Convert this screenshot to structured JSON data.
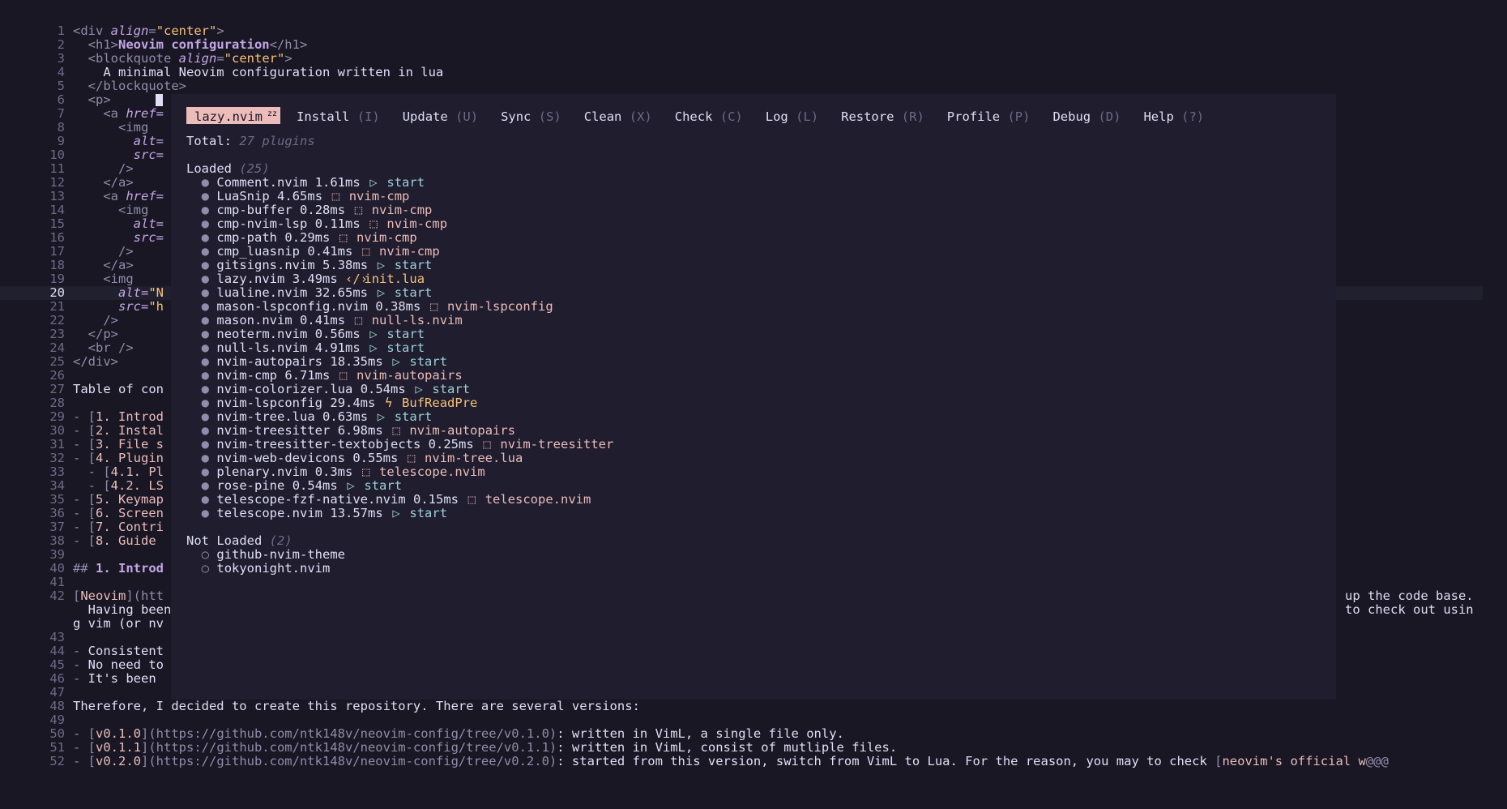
{
  "editor": {
    "lines": [
      {
        "n": "1",
        "segs": [
          [
            "tag",
            "<div "
          ],
          [
            "attr",
            "align"
          ],
          [
            "tag",
            "="
          ],
          [
            "str",
            "\"center\""
          ],
          [
            "tag",
            ">"
          ]
        ]
      },
      {
        "n": "2",
        "segs": [
          [
            "tag",
            "  <h1>"
          ],
          [
            "bold",
            "Neovim configuration"
          ],
          [
            "tag",
            "</h1>"
          ]
        ]
      },
      {
        "n": "3",
        "segs": [
          [
            "tag",
            "  <blockquote "
          ],
          [
            "attr",
            "align"
          ],
          [
            "tag",
            "="
          ],
          [
            "str",
            "\"center\""
          ],
          [
            "tag",
            ">"
          ]
        ]
      },
      {
        "n": "4",
        "segs": [
          [
            "",
            "    A minimal Neovim configuration written in lua"
          ]
        ]
      },
      {
        "n": "5",
        "segs": [
          [
            "tag",
            "  </blockquote>"
          ]
        ]
      },
      {
        "n": "6",
        "segs": [
          [
            "tag",
            "  <p>"
          ]
        ]
      },
      {
        "n": "7",
        "segs": [
          [
            "tag",
            "    <a "
          ],
          [
            "attr",
            "href="
          ]
        ]
      },
      {
        "n": "8",
        "segs": [
          [
            "tag",
            "      <img"
          ]
        ]
      },
      {
        "n": "9",
        "segs": [
          [
            "attr",
            "        alt="
          ]
        ]
      },
      {
        "n": "10",
        "segs": [
          [
            "attr",
            "        src="
          ]
        ]
      },
      {
        "n": "11",
        "segs": [
          [
            "tag",
            "      />"
          ]
        ]
      },
      {
        "n": "12",
        "segs": [
          [
            "tag",
            "    </a>"
          ]
        ]
      },
      {
        "n": "13",
        "segs": [
          [
            "tag",
            "    <a "
          ],
          [
            "attr",
            "href="
          ]
        ]
      },
      {
        "n": "14",
        "segs": [
          [
            "tag",
            "      <img"
          ]
        ]
      },
      {
        "n": "15",
        "segs": [
          [
            "attr",
            "        alt="
          ]
        ]
      },
      {
        "n": "16",
        "segs": [
          [
            "attr",
            "        src="
          ]
        ]
      },
      {
        "n": "17",
        "segs": [
          [
            "tag",
            "      />"
          ]
        ]
      },
      {
        "n": "18",
        "segs": [
          [
            "tag",
            "    </a>"
          ]
        ]
      },
      {
        "n": "19",
        "segs": [
          [
            "tag",
            "    <img"
          ]
        ]
      },
      {
        "n": "20",
        "segs": [
          [
            "attr",
            "      alt="
          ],
          [
            "str",
            "\"N"
          ]
        ],
        "current": true
      },
      {
        "n": "21",
        "segs": [
          [
            "attr",
            "      src="
          ],
          [
            "str",
            "\"h"
          ]
        ]
      },
      {
        "n": "22",
        "segs": [
          [
            "tag",
            "    />"
          ]
        ]
      },
      {
        "n": "23",
        "segs": [
          [
            "tag",
            "  </p>"
          ]
        ]
      },
      {
        "n": "24",
        "segs": [
          [
            "tag",
            "  <br />"
          ]
        ]
      },
      {
        "n": "25",
        "segs": [
          [
            "tag",
            "</div>"
          ]
        ]
      },
      {
        "n": "26",
        "segs": []
      },
      {
        "n": "27",
        "segs": [
          [
            "",
            "Table of con"
          ]
        ]
      },
      {
        "n": "28",
        "segs": []
      },
      {
        "n": "29",
        "segs": [
          [
            "muted",
            "- ["
          ],
          [
            "link",
            "1. Introd"
          ]
        ]
      },
      {
        "n": "30",
        "segs": [
          [
            "muted",
            "- ["
          ],
          [
            "link",
            "2. Instal"
          ]
        ]
      },
      {
        "n": "31",
        "segs": [
          [
            "muted",
            "- ["
          ],
          [
            "link",
            "3. File s"
          ]
        ]
      },
      {
        "n": "32",
        "segs": [
          [
            "muted",
            "- ["
          ],
          [
            "link",
            "4. Plugin"
          ]
        ]
      },
      {
        "n": "33",
        "segs": [
          [
            "muted",
            "  - ["
          ],
          [
            "link",
            "4.1. Pl"
          ]
        ]
      },
      {
        "n": "34",
        "segs": [
          [
            "muted",
            "  - ["
          ],
          [
            "link",
            "4.2. LS"
          ]
        ]
      },
      {
        "n": "35",
        "segs": [
          [
            "muted",
            "- ["
          ],
          [
            "link",
            "5. Keymap"
          ]
        ]
      },
      {
        "n": "36",
        "segs": [
          [
            "muted",
            "- ["
          ],
          [
            "link",
            "6. Screen"
          ]
        ]
      },
      {
        "n": "37",
        "segs": [
          [
            "muted",
            "- ["
          ],
          [
            "link",
            "7. Contri"
          ]
        ]
      },
      {
        "n": "38",
        "segs": [
          [
            "muted",
            "- ["
          ],
          [
            "link",
            "8. Guide"
          ]
        ]
      },
      {
        "n": "39",
        "segs": []
      },
      {
        "n": "40",
        "segs": [
          [
            "muted",
            "## "
          ],
          [
            "hl",
            "1. Introd"
          ]
        ]
      },
      {
        "n": "41",
        "segs": []
      },
      {
        "n": "42",
        "segs": [
          [
            "muted",
            "["
          ],
          [
            "link",
            "Neovim"
          ],
          [
            "muted",
            "](htt"
          ]
        ],
        "right": "up the code base."
      },
      {
        "n": "",
        "segs": [
          [
            "",
            "  Having been"
          ]
        ],
        "right": "to check out usin"
      },
      {
        "n": "",
        "segs": [
          [
            "",
            "g vim (or nv"
          ]
        ]
      },
      {
        "n": "43",
        "segs": []
      },
      {
        "n": "44",
        "segs": [
          [
            "muted",
            "- "
          ],
          [
            "",
            "Consistent"
          ]
        ]
      },
      {
        "n": "45",
        "segs": [
          [
            "muted",
            "- "
          ],
          [
            "",
            "No need to"
          ]
        ]
      },
      {
        "n": "46",
        "segs": [
          [
            "muted",
            "- "
          ],
          [
            "",
            "It's been"
          ]
        ]
      },
      {
        "n": "47",
        "segs": []
      },
      {
        "n": "48",
        "segs": [
          [
            "",
            "Therefore, I decided to create this repository. There are several versions:"
          ]
        ]
      },
      {
        "n": "49",
        "segs": []
      },
      {
        "n": "50",
        "segs": [
          [
            "muted",
            "- ["
          ],
          [
            "link",
            "v0.1.0"
          ],
          [
            "muted",
            "](https://github.com/ntk148v/neovim-config/tree/v0.1.0)"
          ],
          [
            "",
            ": written in VimL, a single file only."
          ]
        ]
      },
      {
        "n": "51",
        "segs": [
          [
            "muted",
            "- ["
          ],
          [
            "link",
            "v0.1.1"
          ],
          [
            "muted",
            "](https://github.com/ntk148v/neovim-config/tree/v0.1.1)"
          ],
          [
            "",
            ": written in VimL, consist of mutliple files."
          ]
        ]
      },
      {
        "n": "52",
        "segs": [
          [
            "muted",
            "- ["
          ],
          [
            "link",
            "v0.2.0"
          ],
          [
            "muted",
            "](https://github.com/ntk148v/neovim-config/tree/v0.2.0)"
          ],
          [
            "",
            ": started from this version, switch from VimL to Lua. For the reason, you may to check "
          ],
          [
            "muted",
            "["
          ],
          [
            "link",
            "neovim's official w"
          ],
          [
            "muted",
            "@@@"
          ]
        ]
      }
    ]
  },
  "lazy": {
    "tabs": [
      {
        "label": "lazy.nvim",
        "key": "",
        "active": true,
        "badge": "zz"
      },
      {
        "label": "Install",
        "key": "(I)"
      },
      {
        "label": "Update",
        "key": "(U)"
      },
      {
        "label": "Sync",
        "key": "(S)"
      },
      {
        "label": "Clean",
        "key": "(X)"
      },
      {
        "label": "Check",
        "key": "(C)"
      },
      {
        "label": "Log",
        "key": "(L)"
      },
      {
        "label": "Restore",
        "key": "(R)"
      },
      {
        "label": "Profile",
        "key": "(P)"
      },
      {
        "label": "Debug",
        "key": "(D)"
      },
      {
        "label": "Help",
        "key": "(?)"
      }
    ],
    "total_label": "Total:",
    "total_value": "27 plugins",
    "loaded_label": "Loaded",
    "loaded_count": "(25)",
    "loaded": [
      {
        "name": "Comment.nvim",
        "time": "1.61ms",
        "kind": "start",
        "icon": "play-icon",
        "src": "start"
      },
      {
        "name": "LuaSnip",
        "time": "4.65ms",
        "kind": "pkg",
        "icon": "package-icon",
        "src": "nvim-cmp"
      },
      {
        "name": "cmp-buffer",
        "time": "0.28ms",
        "kind": "pkg",
        "icon": "package-icon",
        "src": "nvim-cmp"
      },
      {
        "name": "cmp-nvim-lsp",
        "time": "0.11ms",
        "kind": "pkg",
        "icon": "package-icon",
        "src": "nvim-cmp"
      },
      {
        "name": "cmp-path",
        "time": "0.29ms",
        "kind": "pkg",
        "icon": "package-icon",
        "src": "nvim-cmp"
      },
      {
        "name": "cmp_luasnip",
        "time": "0.41ms",
        "kind": "pkg",
        "icon": "package-icon",
        "src": "nvim-cmp"
      },
      {
        "name": "gitsigns.nvim",
        "time": "5.38ms",
        "kind": "start",
        "icon": "play-icon",
        "src": "start"
      },
      {
        "name": "lazy.nvim",
        "time": "3.49ms",
        "kind": "lua",
        "icon": "code-icon",
        "src": "init.lua"
      },
      {
        "name": "lualine.nvim",
        "time": "32.65ms",
        "kind": "start",
        "icon": "play-icon",
        "src": "start"
      },
      {
        "name": "mason-lspconfig.nvim",
        "time": "0.38ms",
        "kind": "pkg",
        "icon": "package-icon",
        "src": "nvim-lspconfig"
      },
      {
        "name": "mason.nvim",
        "time": "0.41ms",
        "kind": "pkg",
        "icon": "package-icon",
        "src": "null-ls.nvim"
      },
      {
        "name": "neoterm.nvim",
        "time": "0.56ms",
        "kind": "start",
        "icon": "play-icon",
        "src": "start"
      },
      {
        "name": "null-ls.nvim",
        "time": "4.91ms",
        "kind": "start",
        "icon": "play-icon",
        "src": "start"
      },
      {
        "name": "nvim-autopairs",
        "time": "18.35ms",
        "kind": "start",
        "icon": "play-icon",
        "src": "start"
      },
      {
        "name": "nvim-cmp",
        "time": "6.71ms",
        "kind": "pkg",
        "icon": "package-icon",
        "src": "nvim-autopairs"
      },
      {
        "name": "nvim-colorizer.lua",
        "time": "0.54ms",
        "kind": "start",
        "icon": "play-icon",
        "src": "start"
      },
      {
        "name": "nvim-lspconfig",
        "time": "29.4ms",
        "kind": "event",
        "icon": "event-icon",
        "src": "BufReadPre"
      },
      {
        "name": "nvim-tree.lua",
        "time": "0.63ms",
        "kind": "start",
        "icon": "play-icon",
        "src": "start"
      },
      {
        "name": "nvim-treesitter",
        "time": "6.98ms",
        "kind": "pkg",
        "icon": "package-icon",
        "src": "nvim-autopairs"
      },
      {
        "name": "nvim-treesitter-textobjects",
        "time": "0.25ms",
        "kind": "pkg",
        "icon": "package-icon",
        "src": "nvim-treesitter"
      },
      {
        "name": "nvim-web-devicons",
        "time": "0.55ms",
        "kind": "pkg",
        "icon": "package-icon",
        "src": "nvim-tree.lua"
      },
      {
        "name": "plenary.nvim",
        "time": "0.3ms",
        "kind": "pkg",
        "icon": "package-icon",
        "src": "telescope.nvim"
      },
      {
        "name": "rose-pine",
        "time": "0.54ms",
        "kind": "start",
        "icon": "play-icon",
        "src": "start"
      },
      {
        "name": "telescope-fzf-native.nvim",
        "time": "0.15ms",
        "kind": "pkg",
        "icon": "package-icon",
        "src": "telescope.nvim"
      },
      {
        "name": "telescope.nvim",
        "time": "13.57ms",
        "kind": "start",
        "icon": "play-icon",
        "src": "start"
      }
    ],
    "notloaded_label": "Not Loaded",
    "notloaded_count": "(2)",
    "notloaded": [
      "github-nvim-theme",
      "tokyonight.nvim"
    ]
  },
  "colors": {
    "background": "#191724",
    "float_background": "#1f1d2e",
    "active_tab": "#ebbcba",
    "foreground": "#e0def4",
    "muted": "#908caa",
    "accent_iris": "#c4a7e7",
    "accent_gold": "#f6c177",
    "accent_foam": "#9ccfd8"
  }
}
